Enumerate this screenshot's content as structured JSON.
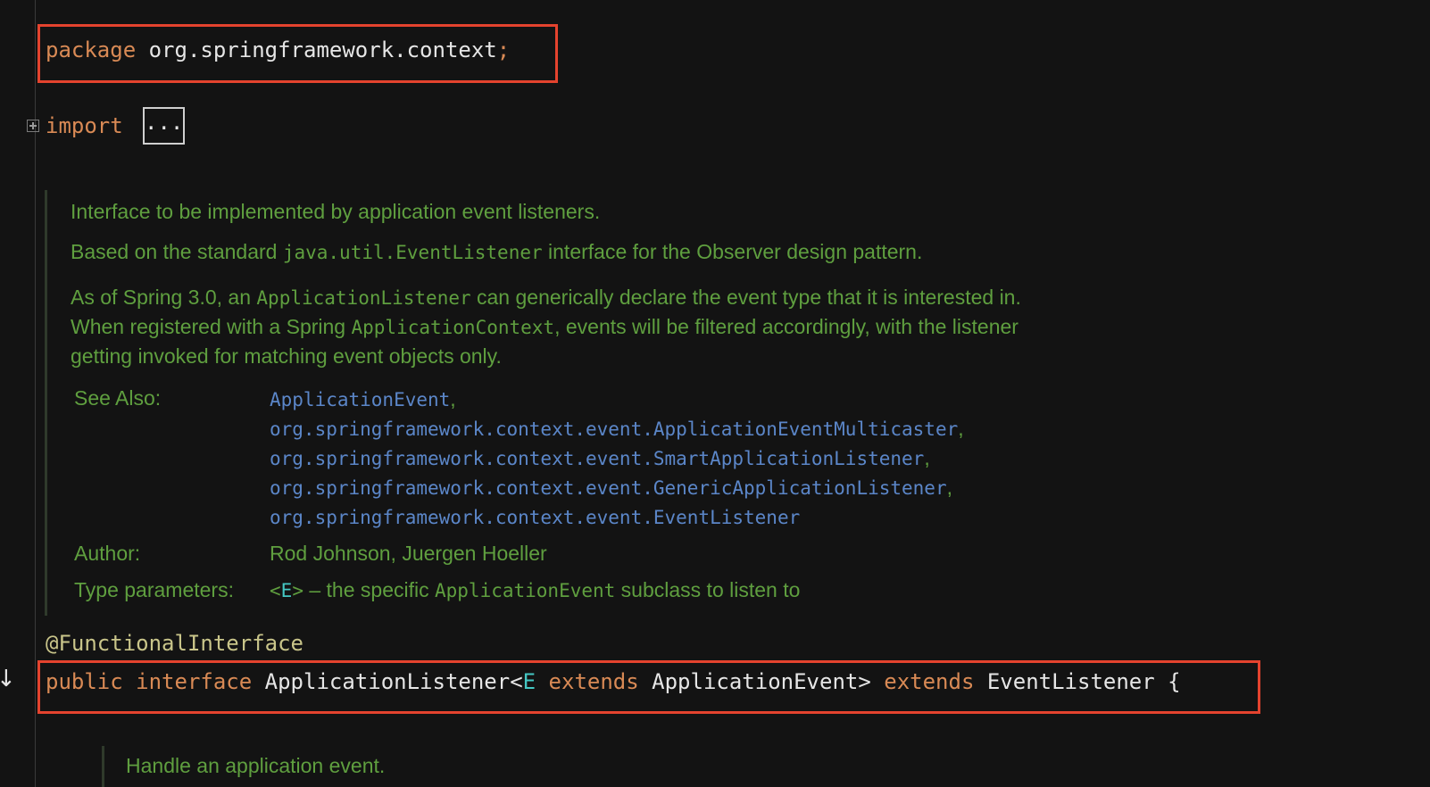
{
  "package_line": {
    "keyword": "package",
    "name": "org.springframework.context",
    "semicolon": ";"
  },
  "import_line": {
    "keyword": "import",
    "collapsed": "..."
  },
  "javadoc": {
    "line1": "Interface to be implemented by application event listeners.",
    "line2_pre": "Based on the standard ",
    "line2_code": "java.util.EventListener",
    "line2_post": " interface for the Observer design pattern.",
    "line3_pre": "As of Spring 3.0, an ",
    "line3_code": "ApplicationListener",
    "line3_post": " can generically declare the event type that it is interested in.",
    "line4_pre": "When registered with a Spring ",
    "line4_code": "ApplicationContext",
    "line4_post": ", events will be filtered accordingly, with the listener",
    "line5": "getting invoked for matching event objects only.",
    "see_also_label": "See Also:",
    "see_also": [
      {
        "text": "ApplicationEvent",
        "sep": ","
      },
      {
        "text": "org.springframework.context.event.ApplicationEventMulticaster",
        "sep": ","
      },
      {
        "text": "org.springframework.context.event.SmartApplicationListener",
        "sep": ","
      },
      {
        "text": "org.springframework.context.event.GenericApplicationListener",
        "sep": ","
      },
      {
        "text": "org.springframework.context.event.EventListener",
        "sep": ""
      }
    ],
    "author_label": "Author:",
    "author_value": "Rod Johnson, Juergen Hoeller",
    "type_params_label": "Type parameters:",
    "type_param_open": "<",
    "type_param_name": "E",
    "type_param_close": ">",
    "type_param_desc_pre": " – the specific ",
    "type_param_desc_code": "ApplicationEvent",
    "type_param_desc_post": " subclass to listen to"
  },
  "annotation": "@FunctionalInterface",
  "declaration": {
    "kw_public": "public",
    "kw_interface": "interface",
    "name": "ApplicationListener<",
    "type_var": "E",
    "kw_extends1": "extends",
    "bound": "ApplicationEvent>",
    "kw_extends2": "extends",
    "super": "EventListener",
    "brace": "{"
  },
  "method_doc": {
    "line1": "Handle an application event."
  },
  "colors": {
    "background": "#131313",
    "keyword": "#d98a55",
    "doc_text": "#5f9f3f",
    "doc_link": "#5b86c8",
    "highlight_box": "#e4432e",
    "type_var": "#45c8c4",
    "annotation": "#c9c58a"
  },
  "icons": {
    "fold": "fold-plus-icon",
    "gutter": "implemented-down-arrow-icon"
  }
}
